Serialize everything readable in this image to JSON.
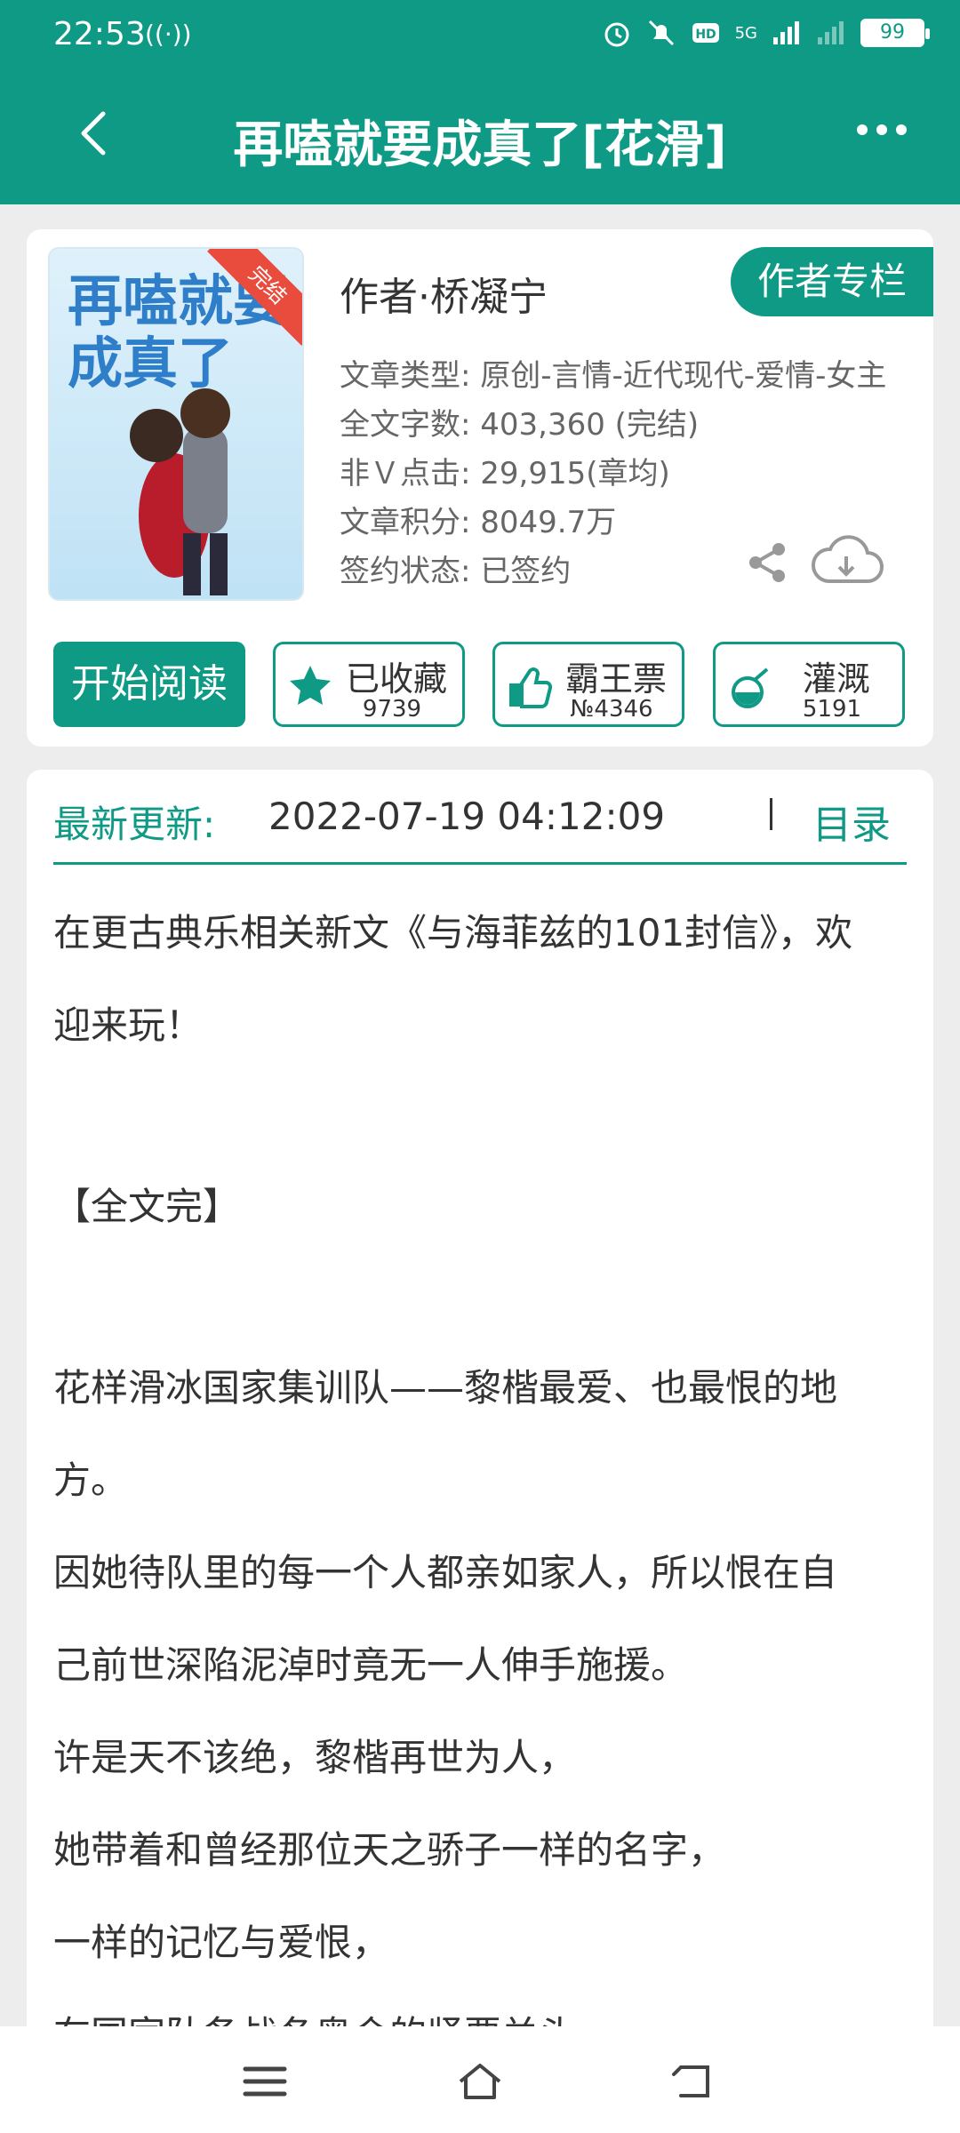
{
  "status": {
    "time": "22:53",
    "signal_text": "((·))",
    "net": "5G",
    "battery": "99"
  },
  "nav": {
    "title": "再嗑就要成真了[花滑]"
  },
  "book": {
    "cover_ribbon": "完结",
    "author": "作者·桥凝宁",
    "author_column": "作者专栏",
    "type": "文章类型: 原创-言情-近代现代-爱情-女主",
    "words": "全文字数: 403,360 (完结)",
    "clicks": "非Ｖ点击: 29,915(章均)",
    "score": "文章积分: 8049.7万",
    "sign": "签约状态: 已签约"
  },
  "actions": {
    "start": "开始阅读",
    "collect": {
      "label": "已收藏",
      "count": "9739"
    },
    "vote": {
      "label": "霸王票",
      "count": "№4346"
    },
    "water": {
      "label": "灌溉",
      "count": "5191"
    }
  },
  "update": {
    "label": "最新更新:",
    "time": "2022-07-19 04:12:09",
    "toc": "目录"
  },
  "paragraphs": [
    "在更古典乐相关新文《与海菲兹的101封信》，欢",
    "迎来玩！",
    "【全文完】",
    "花样滑冰国家集训队——黎楷最爱、也最恨的地",
    "方。",
    "因她待队里的每一个人都亲如家人，所以恨在自",
    "己前世深陷泥淖时竟无一人伸手施援。",
    "许是天不该绝，黎楷再世为人，",
    "她带着和曾经那位天之骄子一样的名字，",
    "一样的记忆与爱恨，",
    "在国家队备战冬奥会的紧要关头，"
  ],
  "colors": {
    "accent": "#0f9a86",
    "ribbon": "#e94b3c"
  }
}
